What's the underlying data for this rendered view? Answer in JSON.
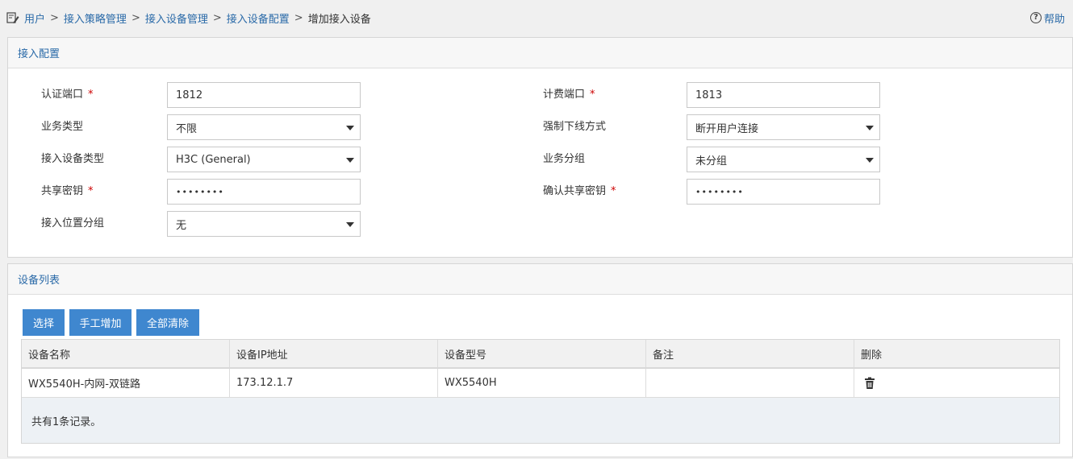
{
  "breadcrumb": {
    "items": [
      "用户",
      "接入策略管理",
      "接入设备管理",
      "接入设备配置"
    ],
    "separator": ">",
    "current": "增加接入设备"
  },
  "help": {
    "label": "帮助"
  },
  "config_panel": {
    "title": "接入配置",
    "fields": {
      "auth_port": {
        "label": "认证端口",
        "value": "1812",
        "required": true
      },
      "acct_port": {
        "label": "计费端口",
        "value": "1813",
        "required": true
      },
      "service_type": {
        "label": "业务类型",
        "value": "不限"
      },
      "force_offline": {
        "label": "强制下线方式",
        "value": "断开用户连接"
      },
      "device_type": {
        "label": "接入设备类型",
        "value": "H3C (General)"
      },
      "service_group": {
        "label": "业务分组",
        "value": "未分组"
      },
      "shared_secret": {
        "label": "共享密钥",
        "value": "••••••••",
        "required": true
      },
      "confirm_secret": {
        "label": "确认共享密钥",
        "value": "••••••••",
        "required": true
      },
      "location_group": {
        "label": "接入位置分组",
        "value": "无"
      }
    },
    "required_mark": "*"
  },
  "device_panel": {
    "title": "设备列表",
    "buttons": {
      "select": "选择",
      "manual_add": "手工增加",
      "clear_all": "全部清除"
    },
    "table": {
      "columns": [
        "设备名称",
        "设备IP地址",
        "设备型号",
        "备注",
        "删除"
      ],
      "rows": [
        {
          "name": "WX5540H-内网-双链路",
          "ip": "173.12.1.7",
          "model": "WX5540H",
          "note": ""
        }
      ],
      "footer": "共有1条记录。"
    }
  },
  "colors": {
    "link": "#2a6aa8",
    "button": "#3f87cf",
    "required": "#cc0000"
  }
}
